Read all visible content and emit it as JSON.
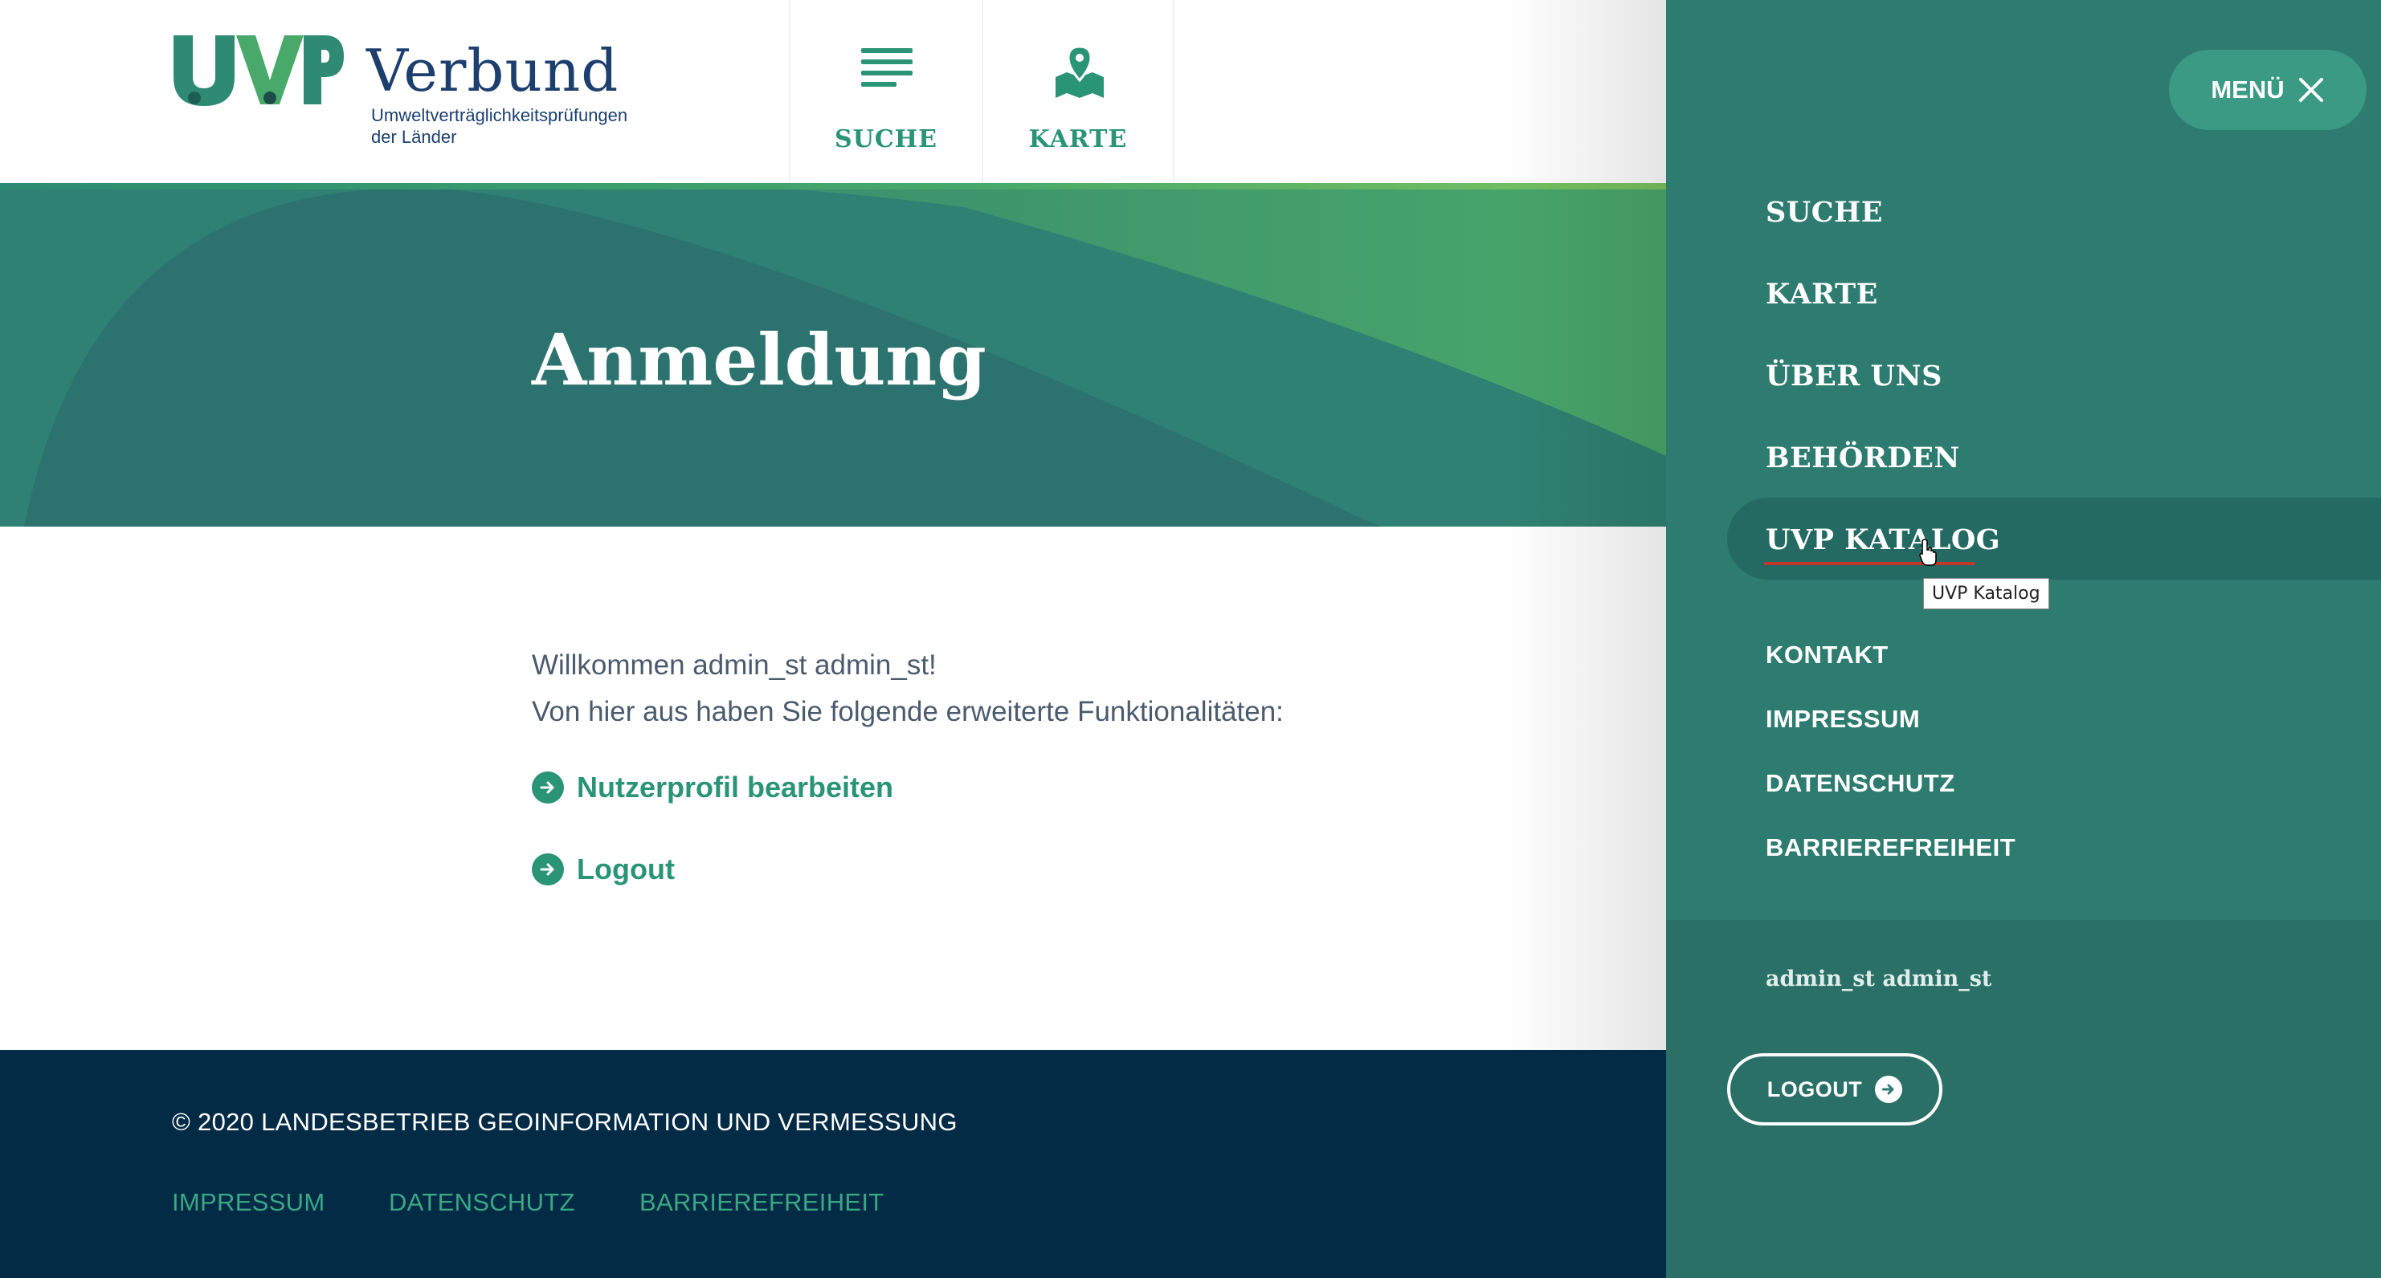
{
  "header": {
    "logo_text": "UVP",
    "logo_name": "Verbund",
    "logo_subtitle": "Umweltverträglichkeitsprüfungen\nder Länder",
    "nav": [
      {
        "label": "SUCHE",
        "icon": "list-icon"
      },
      {
        "label": "KARTE",
        "icon": "map-pin-icon"
      }
    ]
  },
  "hero": {
    "title": "Anmeldung"
  },
  "content": {
    "welcome": "Willkommen admin_st admin_st!",
    "intro": "Von hier aus haben Sie folgende erweiterte Funktionalitäten:",
    "links": [
      {
        "label": "Nutzerprofil bearbeiten",
        "icon": "arrow-right-circle-icon"
      },
      {
        "label": "Logout",
        "icon": "arrow-right-circle-icon"
      }
    ]
  },
  "footer": {
    "copyright": "© 2020 LANDESBETRIEB GEOINFORMATION UND VERMESSUNG",
    "links": [
      "IMPRESSUM",
      "DATENSCHUTZ",
      "BARRIEREFREIHEIT"
    ]
  },
  "side_menu": {
    "close_label": "MENÜ",
    "primary": [
      "SUCHE",
      "KARTE",
      "ÜBER UNS",
      "BEHÖRDEN",
      "UVP KATALOG"
    ],
    "secondary": [
      "KONTAKT",
      "IMPRESSUM",
      "DATENSCHUTZ",
      "BARRIEREFREIHEIT"
    ],
    "tooltip": "UVP Katalog",
    "user_name": "admin_st admin_st",
    "logout_label": "LOGOUT"
  },
  "colors": {
    "brand_green": "#2a9476",
    "panel_teal": "#2e7b70",
    "footer_navy": "#042b45",
    "text_navy": "#1c3f6e"
  }
}
